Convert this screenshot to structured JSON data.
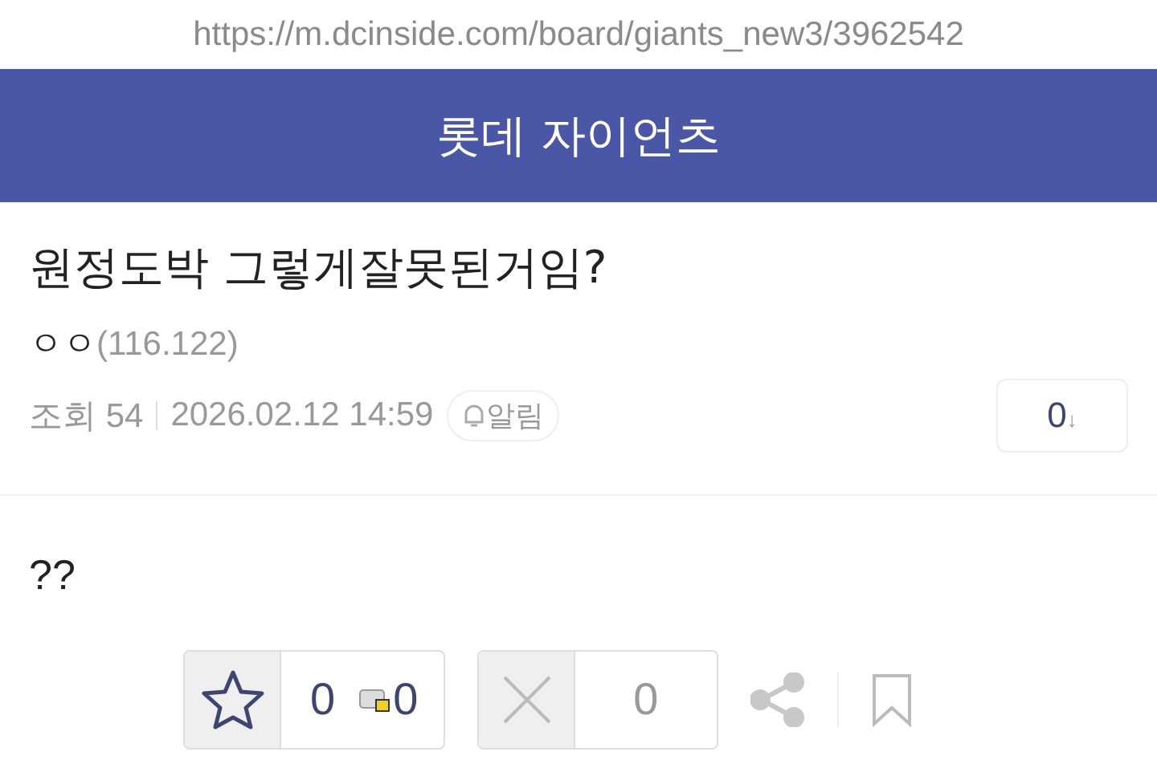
{
  "url": "https://m.dcinside.com/board/giants_new3/3962542",
  "header": {
    "title": "롯데 자이언츠"
  },
  "post": {
    "title": "원정도박 그렇게잘못된거임?",
    "author": "ㅇㅇ",
    "ip": "(116.122)",
    "views_label": "조회 54",
    "date": "2026.02.12 14:59",
    "alert_label": "알림",
    "comment_count": "0",
    "comment_arrow": "↓",
    "body": "??"
  },
  "actions": {
    "recommend": "0",
    "fix_recommend": "0",
    "dislike": "0"
  }
}
